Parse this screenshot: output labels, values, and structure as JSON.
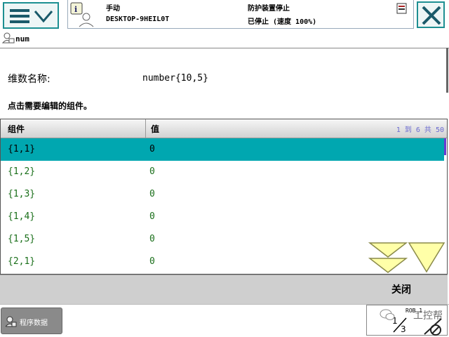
{
  "header": {
    "mode": "手动",
    "host": "DESKTOP-9HEIL0T",
    "safety": "防护装置停止",
    "status": "已停止 (速度 100%)"
  },
  "breadcrumb": {
    "title": "num"
  },
  "info": {
    "dim_label": "维数名称:",
    "dim_value": "number{10,5}",
    "instruction": "点击需要编辑的组件。"
  },
  "table": {
    "col_component": "组件",
    "col_value": "值",
    "range": "1 到 6 共 50",
    "rows": [
      {
        "component": "{1,1}",
        "value": "0"
      },
      {
        "component": "{1,2}",
        "value": "0"
      },
      {
        "component": "{1,3}",
        "value": "0"
      },
      {
        "component": "{1,4}",
        "value": "0"
      },
      {
        "component": "{1,5}",
        "value": "0"
      },
      {
        "component": "{2,1}",
        "value": "0"
      }
    ]
  },
  "buttons": {
    "close": "关闭"
  },
  "taskbar": {
    "program_data": "程序数据",
    "quickset": "ROB_1",
    "fraction": "1/3"
  },
  "watermark": "工控帮",
  "colors": {
    "accent": "#00a7b0",
    "value_text": "#1a6f1a",
    "arrow_fill": "#ffffa8"
  }
}
